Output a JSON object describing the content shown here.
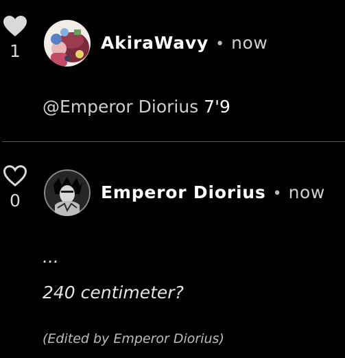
{
  "colors": {
    "background": "#000000",
    "text": "#ffffff",
    "muted": "#cfcfcf",
    "divider": "#5a5a5a"
  },
  "comments": [
    {
      "username": "AkiraWavy",
      "separator": "•",
      "timestamp": "now",
      "like_count": "1",
      "liked": true,
      "like_icon": "heart-filled-icon",
      "avatar_icon": "anime-avatar",
      "mention": "@Emperor Diorius",
      "text": " 7'9"
    },
    {
      "username": "Emperor Diorius",
      "separator": "•",
      "timestamp": "now",
      "like_count": "0",
      "liked": false,
      "like_icon": "heart-outline-icon",
      "avatar_icon": "dark-character-avatar",
      "line_1": "...",
      "line_2": "240 centimeter?",
      "edited_note": "(Edited by Emperor Diorius)"
    }
  ]
}
